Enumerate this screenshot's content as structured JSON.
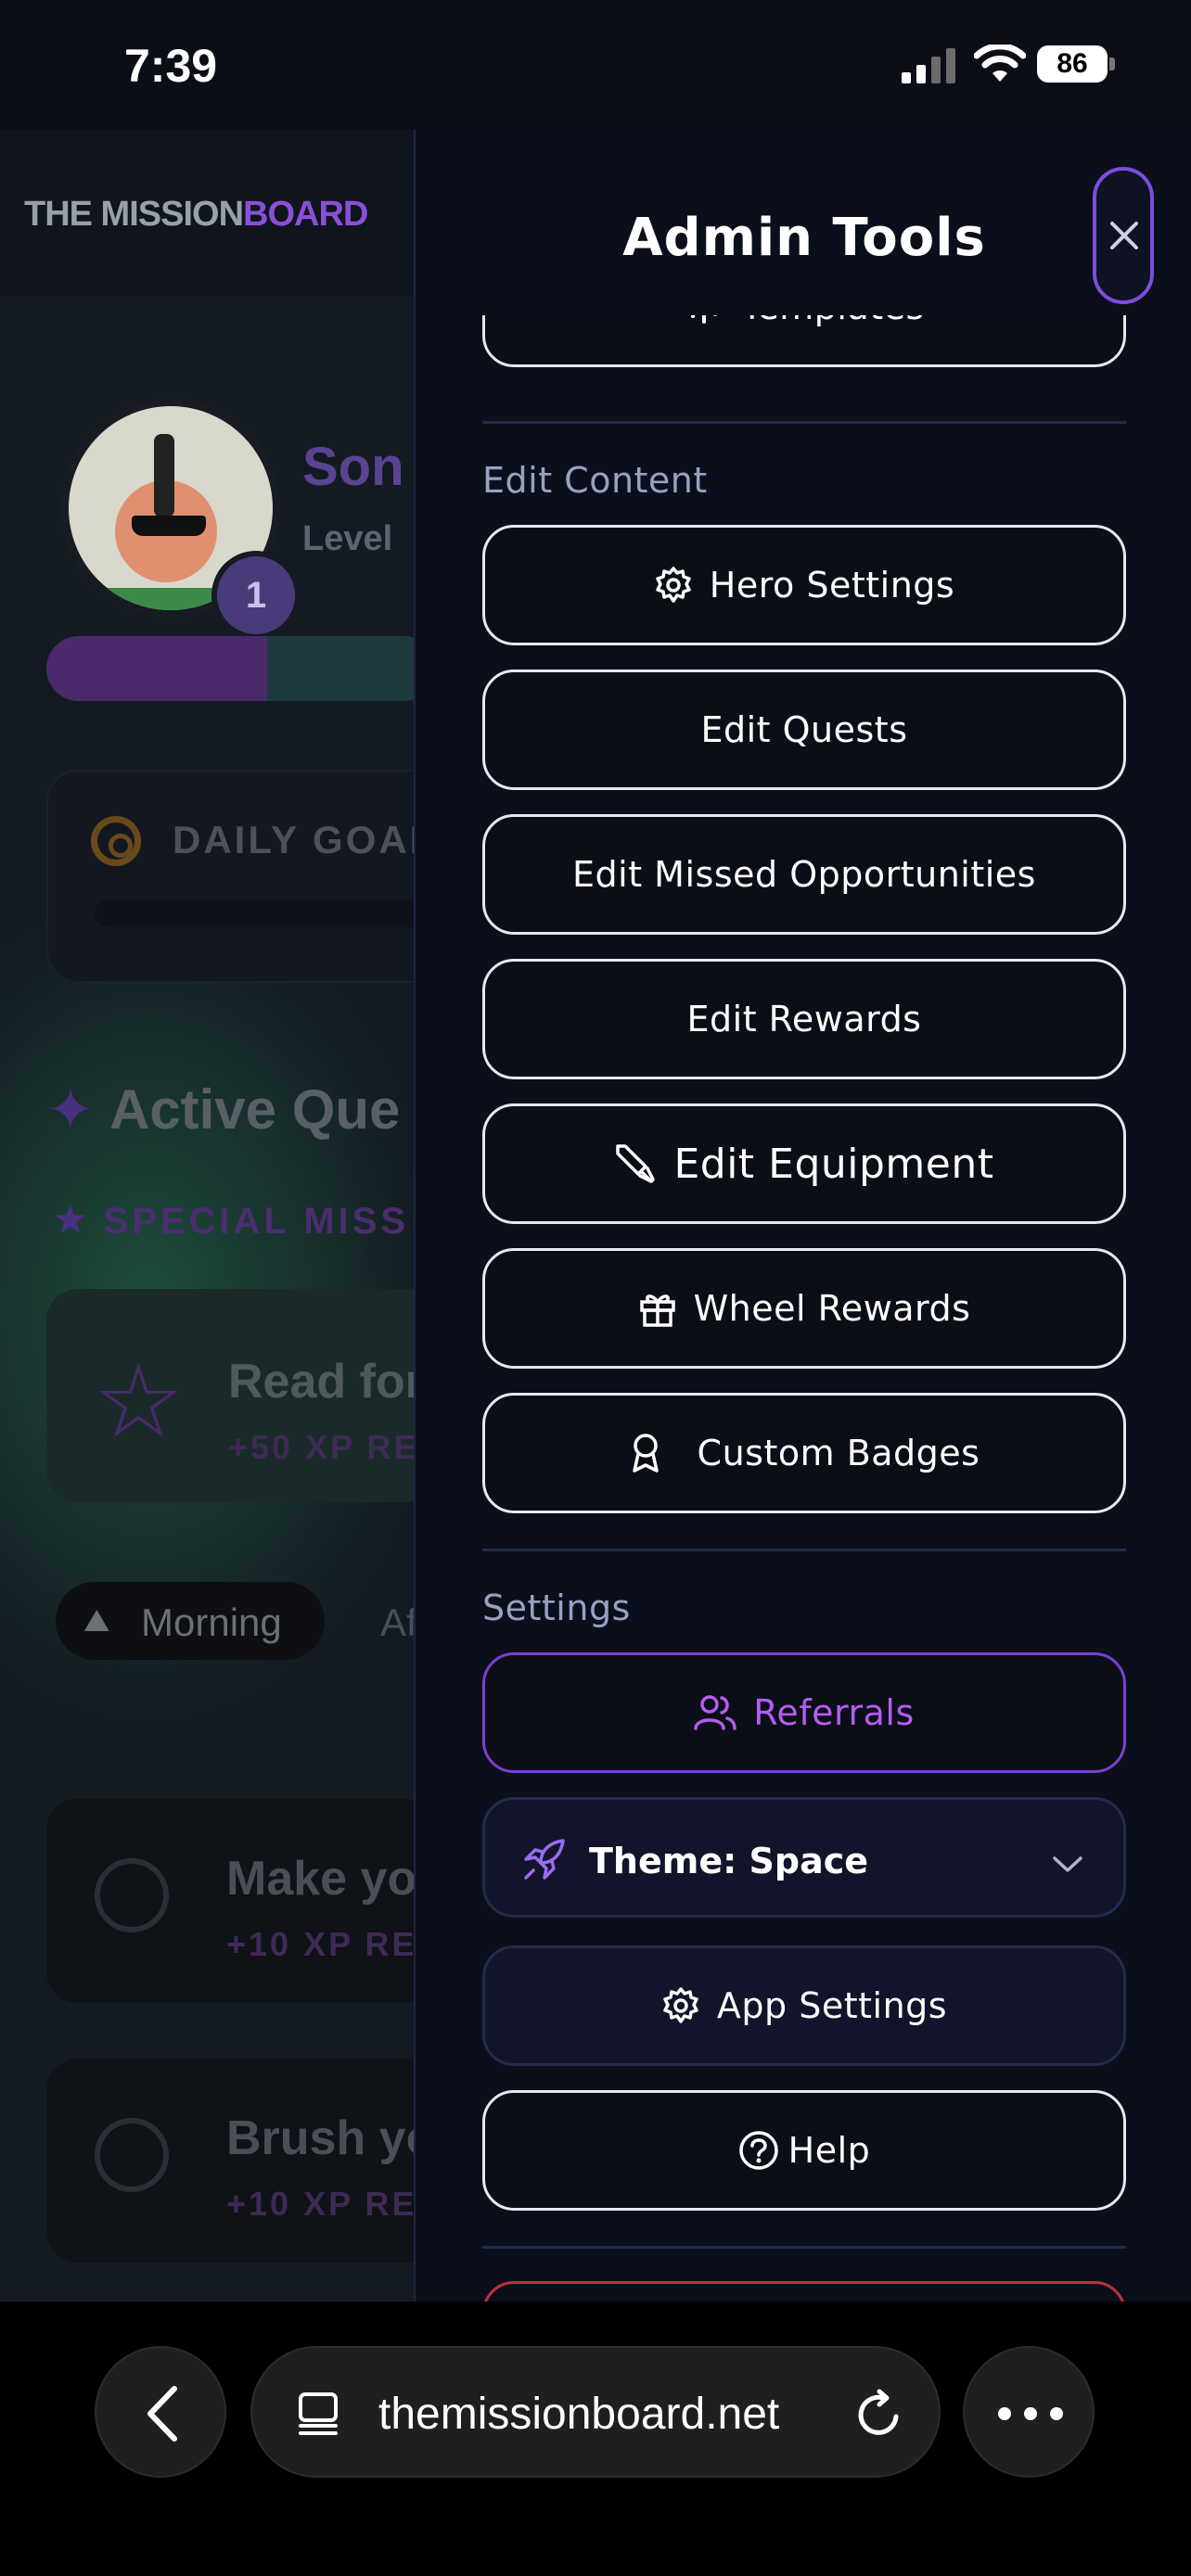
{
  "status_bar": {
    "time": "7:39",
    "battery": "86"
  },
  "background_app": {
    "logo_part1": "THE MISSION",
    "logo_part2": "BOARD",
    "hero_name": "Son",
    "level_label": "Level",
    "level_badge": "1",
    "daily_goal": "DAILY GOAL",
    "active_quests": "Active Que",
    "special_missions": "SPECIAL MISS",
    "quest_title": "Read for",
    "quest_xp": "+50 XP RE",
    "chip_morning": "Morning",
    "chip_next": "Af",
    "tasks": [
      {
        "title": "Make yo",
        "xp": "+10 XP RE"
      },
      {
        "title": "Brush yo",
        "xp": "+10 XP RE"
      }
    ]
  },
  "drawer": {
    "title": "Admin Tools",
    "templates_label": "Templates",
    "edit_content_label": "Edit Content",
    "edit_content": {
      "hero_settings": "Hero Settings",
      "edit_quests": "Edit Quests",
      "edit_missed": "Edit Missed Opportunities",
      "edit_rewards": "Edit Rewards",
      "edit_equipment": "Edit Equipment",
      "wheel_rewards": "Wheel Rewards",
      "custom_badges": "Custom Badges"
    },
    "settings_label": "Settings",
    "settings": {
      "referrals": "Referrals",
      "theme": "Theme: Space",
      "app_settings": "App Settings",
      "help": "Help"
    }
  },
  "browser": {
    "url": "themissionboard.net"
  },
  "colors": {
    "accent_purple": "#7c4ddf",
    "referral_purple": "#b55cf0",
    "background": "#0b0f1c"
  },
  "icons": {
    "close": "close-icon",
    "templates": "templates-icon",
    "hero_settings": "gear-icon",
    "edit_equipment": "sword-icon",
    "wheel_rewards": "gift-icon",
    "custom_badges": "badge-icon",
    "referrals": "users-icon",
    "theme": "rocket-icon",
    "app_settings": "gear-icon",
    "help": "help-circle-icon"
  }
}
